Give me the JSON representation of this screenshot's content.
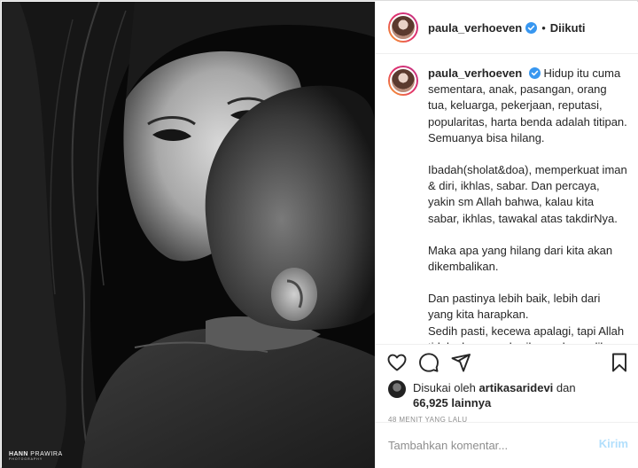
{
  "post": {
    "username": "paula_verhoeven",
    "follow_state": "Diikuti",
    "dot": "•",
    "caption_paragraphs": [
      "Hidup itu cuma sementara, anak, pasangan, orang tua, keluarga, pekerjaan, reputasi, popularitas, harta benda adalah titipan. Semuanya bisa hilang.",
      "Ibadah(sholat&doa), memperkuat iman & diri, ikhlas, sabar. Dan percaya, yakin sm Allah bahwa, kalau kita sabar, ikhlas, tawakal atas takdirNya.",
      "Maka apa yang hilang dari kita akan dikembalikan.",
      "Dan pastinya lebih baik, lebih dari yang kita harapkan.",
      "Sedih pasti, kecewa apalagi, tapi Allah tidak akan memberikan cobaan diluar kemampuan kita. Amin. InsyaAllah 🖤"
    ],
    "likes": {
      "prefix": "Disukai oleh",
      "user": "artikasaridevi",
      "middle": "dan",
      "count": "66,925",
      "suffix": "lainnya"
    },
    "timestamp": "48 MENIT YANG LALU",
    "comment_placeholder": "Tambahkan komentar...",
    "post_button_label": "Kirim"
  },
  "photo": {
    "watermark_bold": "HANN",
    "watermark_light": "PRAWIRA",
    "watermark_sub": "PHOTOGRAPHY"
  },
  "icons": [
    "heart-icon",
    "comment-icon",
    "share-icon",
    "bookmark-icon",
    "verified-badge-icon"
  ],
  "colors": {
    "verified": "#3897f0",
    "post_button_disabled": "#b2dffc",
    "muted_text": "#8e8e8e",
    "border": "#efefef"
  }
}
